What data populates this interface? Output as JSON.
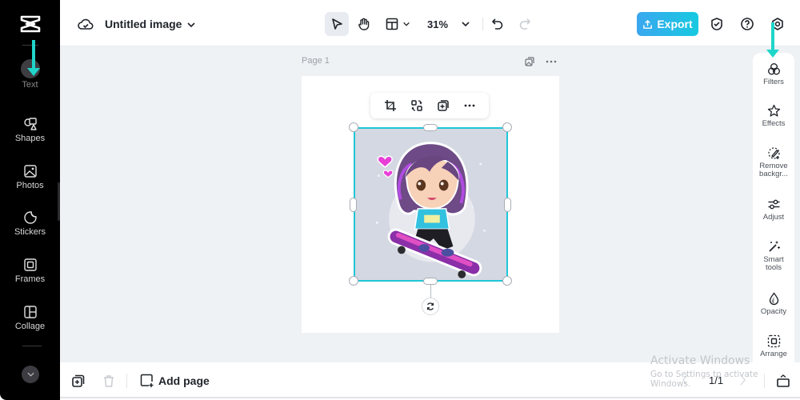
{
  "app": {
    "name": "CapCut"
  },
  "left_sidebar": {
    "items": [
      {
        "id": "text",
        "label": "Text",
        "icon": "text-icon"
      },
      {
        "id": "shapes",
        "label": "Shapes",
        "icon": "shapes-icon"
      },
      {
        "id": "photos",
        "label": "Photos",
        "icon": "photo-icon"
      },
      {
        "id": "stickers",
        "label": "Stickers",
        "icon": "sticker-icon"
      },
      {
        "id": "frames",
        "label": "Frames",
        "icon": "frame-icon"
      },
      {
        "id": "collage",
        "label": "Collage",
        "icon": "collage-icon"
      }
    ]
  },
  "header": {
    "title": "Untitled image",
    "zoom": "31%",
    "export_label": "Export"
  },
  "canvas": {
    "page_label": "Page 1"
  },
  "right_panel": {
    "items": [
      {
        "id": "filters",
        "label": "Filters"
      },
      {
        "id": "effects",
        "label": "Effects"
      },
      {
        "id": "remove-bg",
        "label": "Remove backgr..."
      },
      {
        "id": "adjust",
        "label": "Adjust"
      },
      {
        "id": "smart-tools",
        "label": "Smart tools"
      },
      {
        "id": "opacity",
        "label": "Opacity"
      },
      {
        "id": "arrange",
        "label": "Arrange"
      }
    ]
  },
  "footer": {
    "add_page_label": "Add page",
    "page_indicator": "1/1"
  },
  "watermark": {
    "line1": "Activate Windows",
    "line2": "Go to Settings to activate Windows."
  },
  "colors": {
    "accent": "#1fc6d8",
    "export_gradient_start": "#3aa7f0",
    "export_gradient_end": "#17c9e0",
    "annotation_arrow": "#1fd6c9"
  }
}
